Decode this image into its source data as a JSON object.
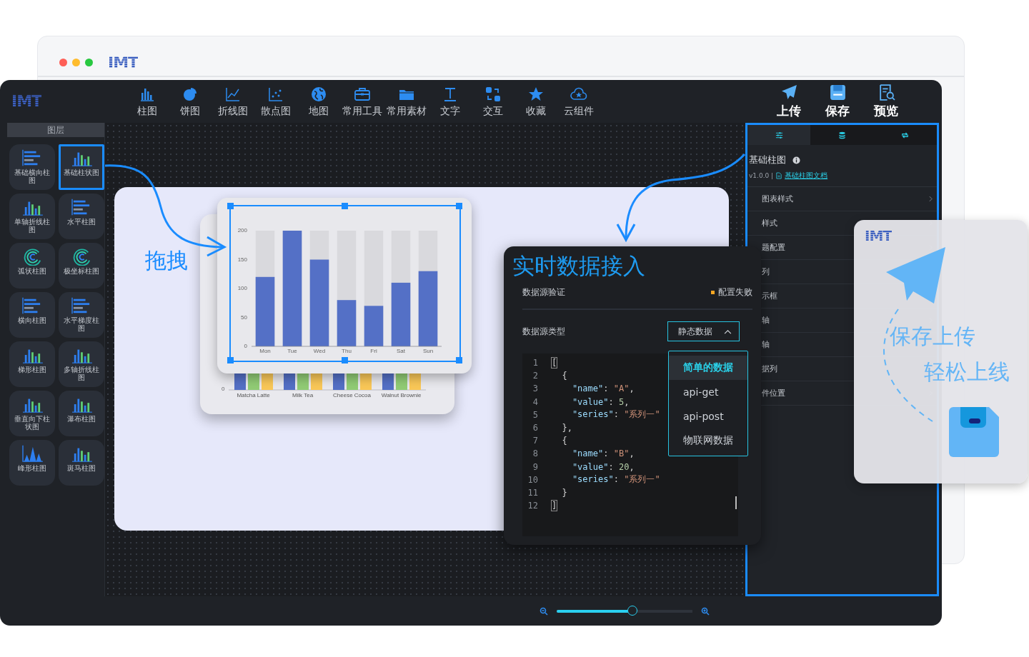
{
  "browser": {
    "logo": "IMT"
  },
  "header": {
    "logo": "IMT",
    "items": [
      {
        "label": "柱图"
      },
      {
        "label": "饼图"
      },
      {
        "label": "折线图"
      },
      {
        "label": "散点图"
      },
      {
        "label": "地图"
      },
      {
        "label": "常用工具"
      },
      {
        "label": "常用素材"
      },
      {
        "label": "文字"
      },
      {
        "label": "交互"
      },
      {
        "label": "收藏"
      },
      {
        "label": "云组件"
      }
    ],
    "actions": [
      {
        "label": "上传"
      },
      {
        "label": "保存"
      },
      {
        "label": "预览"
      }
    ]
  },
  "sidebar": {
    "title": "图层",
    "items": [
      {
        "label": "基础横向柱图",
        "selected": false
      },
      {
        "label": "基础柱状图",
        "selected": true
      },
      {
        "label": "单轴折线柱图",
        "selected": false
      },
      {
        "label": "水平柱图",
        "selected": false
      },
      {
        "label": "弧状柱图",
        "selected": false
      },
      {
        "label": "极坐标柱图",
        "selected": false
      },
      {
        "label": "横向柱图",
        "selected": false
      },
      {
        "label": "水平梯度柱图",
        "selected": false
      },
      {
        "label": "梯形柱图",
        "selected": false
      },
      {
        "label": "多轴折线柱图",
        "selected": false
      },
      {
        "label": "垂直向下柱状图",
        "selected": false
      },
      {
        "label": "瀑布柱图",
        "selected": false
      },
      {
        "label": "峰形柱图",
        "selected": false
      },
      {
        "label": "斑马柱图",
        "selected": false
      }
    ]
  },
  "canvas": {
    "drag_label": "拖拽",
    "back_chart": {
      "y_tick": "0",
      "categories": [
        "Matcha Latte",
        "Milk Tea",
        "Cheese Cocoa",
        "Walnut Brownie"
      ]
    },
    "chart": {
      "selected": true,
      "chart_data": {
        "type": "bar",
        "categories": [
          "Mon",
          "Tue",
          "Wed",
          "Thu",
          "Fri",
          "Sat",
          "Sun"
        ],
        "series": [
          {
            "color": "#5470c6",
            "values": [
              120,
              200,
              150,
              80,
              70,
              110,
              130
            ]
          }
        ],
        "ylim": [
          0,
          200
        ],
        "yticks": [
          0,
          50,
          100,
          150,
          200
        ]
      }
    }
  },
  "data_panel": {
    "title": "实时数据接入",
    "validation": {
      "label": "数据源验证",
      "status": "配置失败"
    },
    "source": {
      "label": "数据源类型",
      "value": "静态数据",
      "expanded": true,
      "options": [
        {
          "label": "简单的数据",
          "selected": true
        },
        {
          "label": "api-get",
          "selected": false
        },
        {
          "label": "api-post",
          "selected": false
        },
        {
          "label": "物联网数据",
          "selected": false
        }
      ]
    },
    "code": [
      {
        "no": "1",
        "tokens": [
          {
            "text": "[",
            "kind": "match"
          }
        ]
      },
      {
        "no": "2",
        "tokens": [
          {
            "text": "  {",
            "kind": "punct"
          }
        ]
      },
      {
        "no": "3",
        "tokens": [
          {
            "text": "    \"name\"",
            "kind": "key"
          },
          {
            "text": ": ",
            "kind": "punct"
          },
          {
            "text": "\"A\"",
            "kind": "string"
          },
          {
            "text": ",",
            "kind": "punct"
          }
        ]
      },
      {
        "no": "4",
        "tokens": [
          {
            "text": "    \"value\"",
            "kind": "key"
          },
          {
            "text": ": ",
            "kind": "punct"
          },
          {
            "text": "5",
            "kind": "number"
          },
          {
            "text": ",",
            "kind": "punct"
          }
        ]
      },
      {
        "no": "5",
        "tokens": [
          {
            "text": "    \"series\"",
            "kind": "key"
          },
          {
            "text": ": ",
            "kind": "punct"
          },
          {
            "text": "\"系列一\"",
            "kind": "string"
          }
        ]
      },
      {
        "no": "6",
        "tokens": [
          {
            "text": "  },",
            "kind": "punct"
          }
        ]
      },
      {
        "no": "7",
        "tokens": [
          {
            "text": "  {",
            "kind": "punct"
          }
        ]
      },
      {
        "no": "8",
        "tokens": [
          {
            "text": "    \"name\"",
            "kind": "key"
          },
          {
            "text": ": ",
            "kind": "punct"
          },
          {
            "text": "\"B\"",
            "kind": "string"
          },
          {
            "text": ",",
            "kind": "punct"
          }
        ]
      },
      {
        "no": "9",
        "tokens": [
          {
            "text": "    \"value\"",
            "kind": "key"
          },
          {
            "text": ": ",
            "kind": "punct"
          },
          {
            "text": "20",
            "kind": "number"
          },
          {
            "text": ",",
            "kind": "punct"
          }
        ]
      },
      {
        "no": "10",
        "tokens": [
          {
            "text": "    \"series\"",
            "kind": "key"
          },
          {
            "text": ": ",
            "kind": "punct"
          },
          {
            "text": "\"系列一\"",
            "kind": "string"
          }
        ]
      },
      {
        "no": "11",
        "tokens": [
          {
            "text": "  }",
            "kind": "punct"
          }
        ]
      },
      {
        "no": "12",
        "tokens": [
          {
            "text": "]",
            "kind": "match"
          }
        ]
      }
    ]
  },
  "properties": {
    "tabs": [
      {
        "selected": true
      },
      {
        "selected": false
      },
      {
        "selected": false
      }
    ],
    "title": "基础柱图",
    "version": "v1.0.0 |",
    "doc_link": "基础柱图文档",
    "rows": [
      {
        "label": "图表样式"
      },
      {
        "label": "样式"
      },
      {
        "label": "题配置"
      },
      {
        "label": "列"
      },
      {
        "label": "示框"
      },
      {
        "label": "轴"
      },
      {
        "label": "轴"
      },
      {
        "label": "据列"
      },
      {
        "label": "件位置"
      }
    ]
  },
  "zoom": {
    "level": 0.56
  },
  "promo": {
    "logo": "IMT",
    "line_1": "保存上传",
    "line_2": "轻松上线"
  }
}
